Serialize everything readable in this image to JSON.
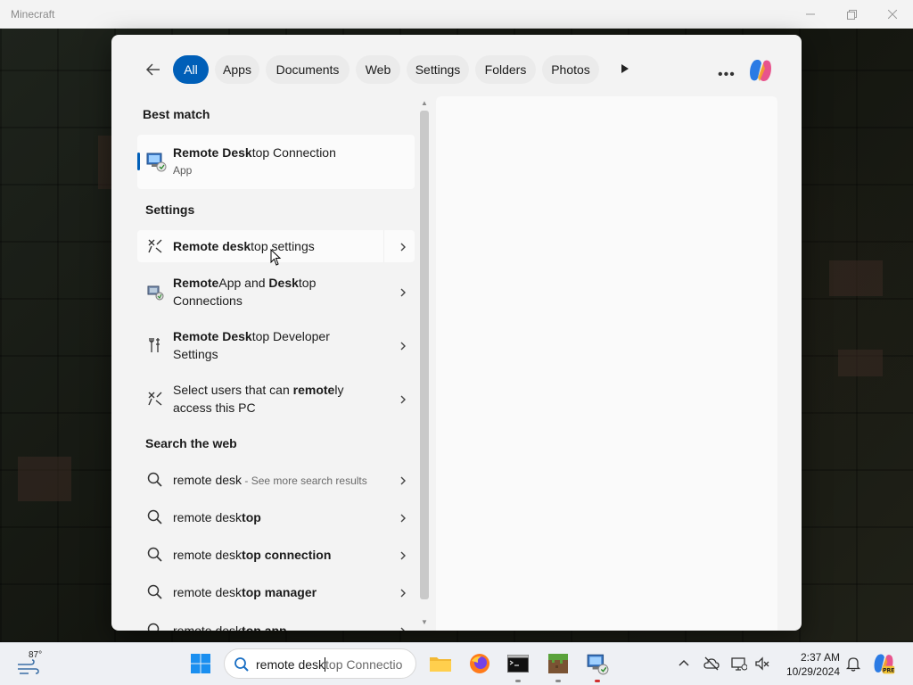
{
  "window": {
    "title": "Minecraft"
  },
  "search_panel": {
    "filters": [
      "All",
      "Apps",
      "Documents",
      "Web",
      "Settings",
      "Folders",
      "Photos"
    ],
    "best_match": {
      "heading": "Best match",
      "title_bold": "Remote Desk",
      "title_rest": "top Connection",
      "type": "App"
    },
    "settings": {
      "heading": "Settings",
      "items": [
        {
          "bold": "Remote desk",
          "rest": "top settings",
          "line2": ""
        },
        {
          "bold": "Remote",
          "rest": "App and ",
          "bold2": "Desk",
          "rest2": "top",
          "line2": "Connections"
        },
        {
          "bold": "Remote Desk",
          "rest": "top Developer",
          "line2": "Settings"
        },
        {
          "pre": "Select users that can ",
          "bold": "remote",
          "rest": "ly",
          "line2": "access this PC"
        }
      ]
    },
    "web": {
      "heading": "Search the web",
      "items": [
        {
          "plain": "remote desk",
          "hint": " - See more search results"
        },
        {
          "plain": "remote desk",
          "bold": "top"
        },
        {
          "plain": "remote desk",
          "bold": "top connection"
        },
        {
          "plain": "remote desk",
          "bold": "top manager"
        },
        {
          "plain": "remote desk",
          "bold": "top app"
        }
      ]
    }
  },
  "taskbar": {
    "weather_temp": "87°",
    "search_typed": "remote desk",
    "search_suggest": "top Connectio",
    "time": "2:37 AM",
    "date": "10/29/2024"
  },
  "colors": {
    "accent": "#005fb8",
    "panel_bg": "#f3f3f3",
    "taskbar_bg": "#eef0f4"
  }
}
